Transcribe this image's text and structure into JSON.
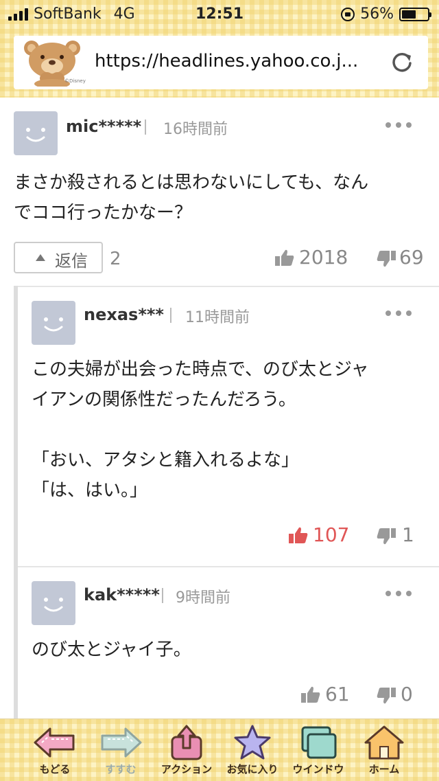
{
  "status": {
    "carrier": "SoftBank",
    "network": "4G",
    "time": "12:51",
    "battery": "56%",
    "battery_level": 0.56
  },
  "browser": {
    "url": "https://headlines.yahoo.co.j...",
    "logo_text": "©Disney"
  },
  "comments": [
    {
      "user": "mic*****",
      "time": "16時間前",
      "lines": [
        "まさか殺されるとは思わないにしても、なん",
        "でココ行ったかなー？"
      ],
      "reply_label": "返信",
      "reply_count": "2",
      "likes": "2018",
      "dislikes": "69"
    },
    {
      "user": "nexas***",
      "time": "11時間前",
      "lines": [
        "この夫婦が出会った時点で、のび太とジャ",
        "イアンの関係性だったんだろう。",
        "",
        "「おい、アタシと籍入れるよな」",
        "「は、はい。」"
      ],
      "likes": "107",
      "dislikes": "1"
    },
    {
      "user": "kak*****",
      "time": "9時間前",
      "lines": [
        "のび太とジャイ子。"
      ],
      "likes": "61",
      "dislikes": "0"
    }
  ],
  "toolbar": {
    "back": "もどる",
    "forward": "すすむ",
    "action": "アクション",
    "favorites": "お気に入り",
    "window": "ウインドウ",
    "home": "ホーム"
  },
  "colors": {
    "like_active": "#e05656",
    "muted": "#888888",
    "toolbar_bg": "#fdf3c4"
  }
}
